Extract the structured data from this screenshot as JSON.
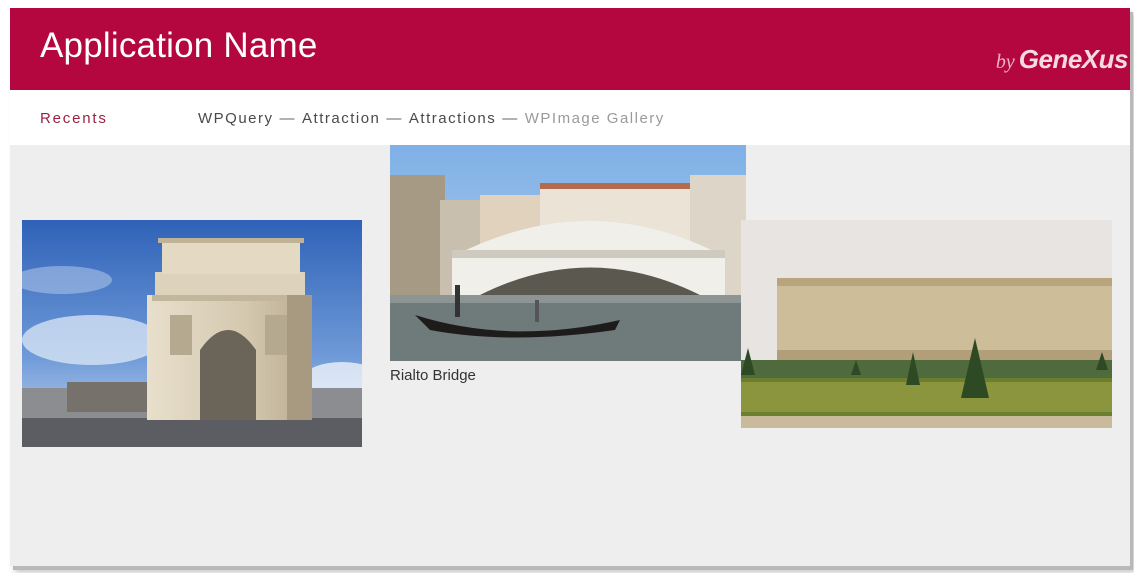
{
  "header": {
    "app_title": "Application Name",
    "brand_by": "by",
    "brand_name": "GeneXus",
    "color": "#b5073f"
  },
  "navbar": {
    "recents_label": "Recents",
    "breadcrumb": [
      {
        "label": "WPQuery"
      },
      {
        "label": "Attraction"
      },
      {
        "label": "Attractions"
      },
      {
        "label": "WPImage Gallery",
        "current": true
      }
    ],
    "separator": "—"
  },
  "gallery": {
    "images": [
      {
        "subject": "arc-de-triomphe",
        "caption": ""
      },
      {
        "subject": "rialto-bridge",
        "caption": "Rialto Bridge"
      },
      {
        "subject": "palace-of-versailles",
        "caption": ""
      }
    ]
  }
}
